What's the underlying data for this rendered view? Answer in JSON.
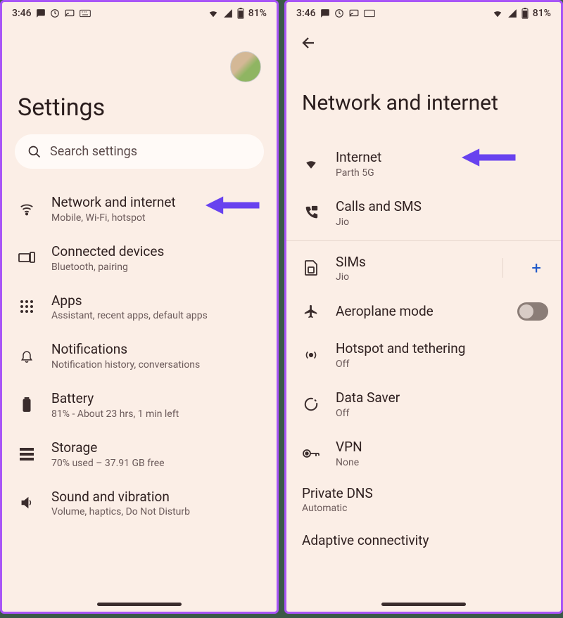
{
  "statusbar": {
    "time": "3:46",
    "battery": "81%"
  },
  "left": {
    "title": "Settings",
    "search_placeholder": "Search settings",
    "items": [
      {
        "title": "Network and internet",
        "sub": "Mobile, Wi-Fi, hotspot"
      },
      {
        "title": "Connected devices",
        "sub": "Bluetooth, pairing"
      },
      {
        "title": "Apps",
        "sub": "Assistant, recent apps, default apps"
      },
      {
        "title": "Notifications",
        "sub": "Notification history, conversations"
      },
      {
        "title": "Battery",
        "sub": "81% - About 23 hrs, 1 min left"
      },
      {
        "title": "Storage",
        "sub": "70% used – 37.91 GB free"
      },
      {
        "title": "Sound and vibration",
        "sub": "Volume, haptics, Do Not Disturb"
      }
    ]
  },
  "right": {
    "title": "Network and internet",
    "items": [
      {
        "title": "Internet",
        "sub": "Parth 5G"
      },
      {
        "title": "Calls and SMS",
        "sub": "Jio"
      },
      {
        "title": "SIMs",
        "sub": "Jio"
      },
      {
        "title": "Aeroplane mode",
        "sub": ""
      },
      {
        "title": "Hotspot and tethering",
        "sub": "Off"
      },
      {
        "title": "Data Saver",
        "sub": "Off"
      },
      {
        "title": "VPN",
        "sub": "None"
      }
    ],
    "private_dns": {
      "title": "Private DNS",
      "sub": "Automatic"
    },
    "adaptive": "Adaptive connectivity"
  }
}
